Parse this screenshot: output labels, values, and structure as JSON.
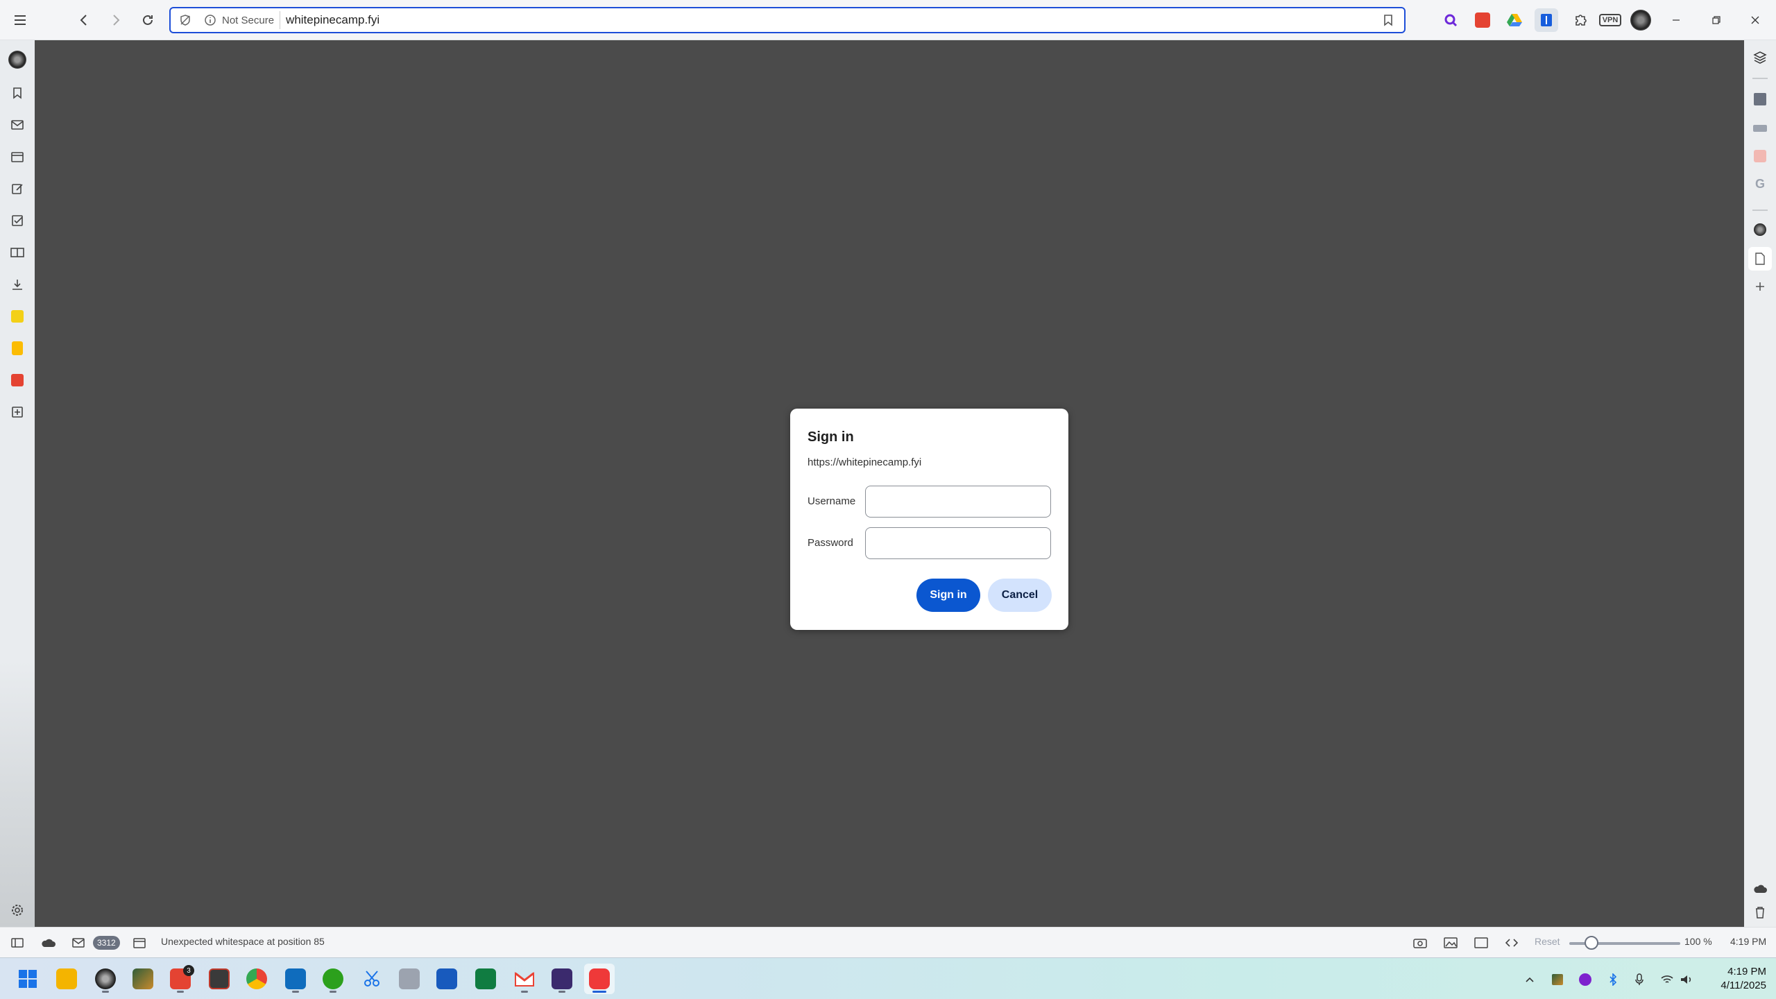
{
  "browser": {
    "address": {
      "security_label": "Not Secure",
      "url": "whitepinecamp.fyi"
    },
    "extensions": [
      "search-ext-icon",
      "todoist-icon",
      "google-drive-icon",
      "bitwarden-icon",
      "puzzle-icon"
    ],
    "vpn_label": "VPN"
  },
  "dialog": {
    "title": "Sign in",
    "origin": "https://whitepinecamp.fyi",
    "username_label": "Username",
    "password_label": "Password",
    "username_value": "",
    "password_value": "",
    "sign_in_label": "Sign in",
    "cancel_label": "Cancel"
  },
  "statusbar": {
    "mail_count": "3312",
    "message": "Unexpected whitespace at position 85",
    "reset_label": "Reset",
    "zoom_value": "100 %",
    "zoom_fraction": 0.2,
    "time": "4:19 PM"
  },
  "taskbar": {
    "todoist_badge": "3",
    "clock_time": "4:19 PM",
    "clock_date": "4/11/2025"
  },
  "colors": {
    "accent": "#0b57d0",
    "secondary": "#d3e3fd",
    "content_bg": "#4b4b4b"
  }
}
